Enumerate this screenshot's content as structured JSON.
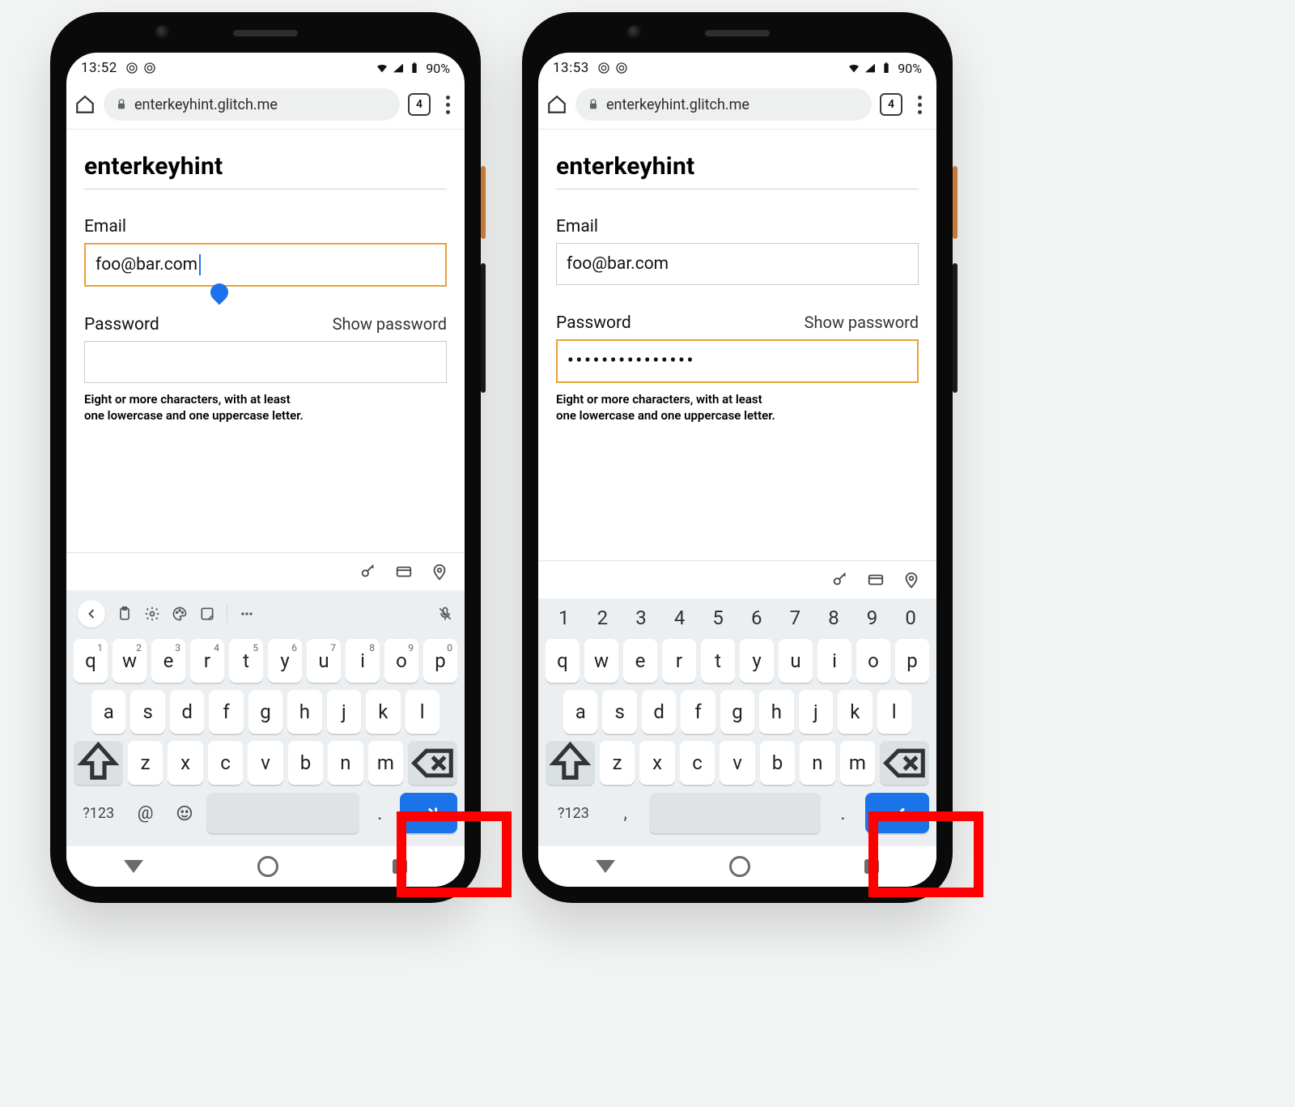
{
  "phones": [
    {
      "status": {
        "time": "13:52",
        "battery": "90%"
      },
      "omnibox": {
        "url": "enterkeyhint.glitch.me",
        "tab_count": "4"
      },
      "page": {
        "title": "enterkeyhint",
        "email_label": "Email",
        "email_value": "foo@bar.com",
        "password_label": "Password",
        "show_password": "Show password",
        "password_value": "",
        "hint_line1": "Eight or more characters, with at least",
        "hint_line2": "one lowercase and one uppercase letter.",
        "focused": "email"
      },
      "keyboard": {
        "variant": "email",
        "symkey": "?123",
        "extra1": "@",
        "extra2": ".",
        "enter_hint": "next"
      }
    },
    {
      "status": {
        "time": "13:53",
        "battery": "90%"
      },
      "omnibox": {
        "url": "enterkeyhint.glitch.me",
        "tab_count": "4"
      },
      "page": {
        "title": "enterkeyhint",
        "email_label": "Email",
        "email_value": "foo@bar.com",
        "password_label": "Password",
        "show_password": "Show password",
        "password_value": "•••••••••••••••",
        "hint_line1": "Eight or more characters, with at least",
        "hint_line2": "one lowercase and one uppercase letter.",
        "focused": "password"
      },
      "keyboard": {
        "variant": "password",
        "symkey": "?123",
        "extra1": ",",
        "extra2": ".",
        "enter_hint": "done"
      }
    }
  ],
  "keys": {
    "row1": [
      "q",
      "w",
      "e",
      "r",
      "t",
      "y",
      "u",
      "i",
      "o",
      "p"
    ],
    "row1sup": [
      "1",
      "2",
      "3",
      "4",
      "5",
      "6",
      "7",
      "8",
      "9",
      "0"
    ],
    "row2": [
      "a",
      "s",
      "d",
      "f",
      "g",
      "h",
      "j",
      "k",
      "l"
    ],
    "row3": [
      "z",
      "x",
      "c",
      "v",
      "b",
      "n",
      "m"
    ],
    "numrow": [
      "1",
      "2",
      "3",
      "4",
      "5",
      "6",
      "7",
      "8",
      "9",
      "0"
    ]
  }
}
